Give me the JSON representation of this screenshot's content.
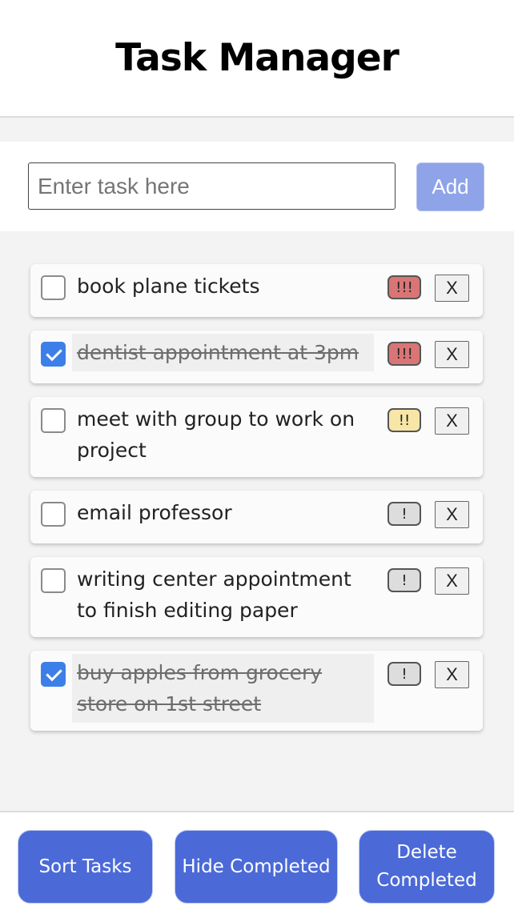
{
  "header": {
    "title": "Task Manager"
  },
  "input_bar": {
    "placeholder": "Enter task here",
    "value": "",
    "add_label": "Add"
  },
  "tasks": [
    {
      "text": "book plane tickets",
      "completed": false,
      "priority": "high",
      "priority_label": "!!!",
      "delete_label": "X"
    },
    {
      "text": "dentist appointment at 3pm",
      "completed": true,
      "priority": "high",
      "priority_label": "!!!",
      "delete_label": "X"
    },
    {
      "text": "meet with group to work on project",
      "completed": false,
      "priority": "medium",
      "priority_label": "!!",
      "delete_label": "X"
    },
    {
      "text": "email professor",
      "completed": false,
      "priority": "low",
      "priority_label": "!",
      "delete_label": "X"
    },
    {
      "text": "writing center appointment to finish editing paper",
      "completed": false,
      "priority": "low",
      "priority_label": "!",
      "delete_label": "X"
    },
    {
      "text": "buy apples from grocery store on 1st street",
      "completed": true,
      "priority": "low",
      "priority_label": "!",
      "delete_label": "X"
    }
  ],
  "footer": {
    "sort_label": "Sort Tasks",
    "hide_label": "Hide Completed",
    "delete_label": "Delete Completed"
  },
  "colors": {
    "accent": "#4b6ad8",
    "add_button": "#8ea3e8",
    "priority_high": "#d97575",
    "priority_medium": "#f7e6a6",
    "priority_low": "#dddddd",
    "checkbox_checked": "#3d7fe8"
  }
}
